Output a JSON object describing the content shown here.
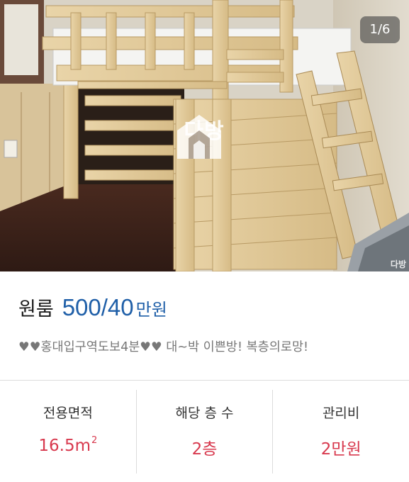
{
  "photo": {
    "counter": "1/6",
    "watermark_text": "다방",
    "watermark_small": "다방"
  },
  "listing": {
    "room_type": "원룸",
    "price": "500/40",
    "price_unit": "만원",
    "description": "♥♥홍대입구역도보4분♥♥ 대~박 이쁜방! 복층의로망!"
  },
  "stats": [
    {
      "label": "전용면적",
      "value": "16.5m",
      "sup": "2"
    },
    {
      "label": "해당 층 수",
      "value": "2층"
    },
    {
      "label": "관리비",
      "value": "2만원"
    }
  ],
  "colors": {
    "price": "#1f5fa8",
    "stat_value": "#d8394e",
    "description": "#777777"
  }
}
